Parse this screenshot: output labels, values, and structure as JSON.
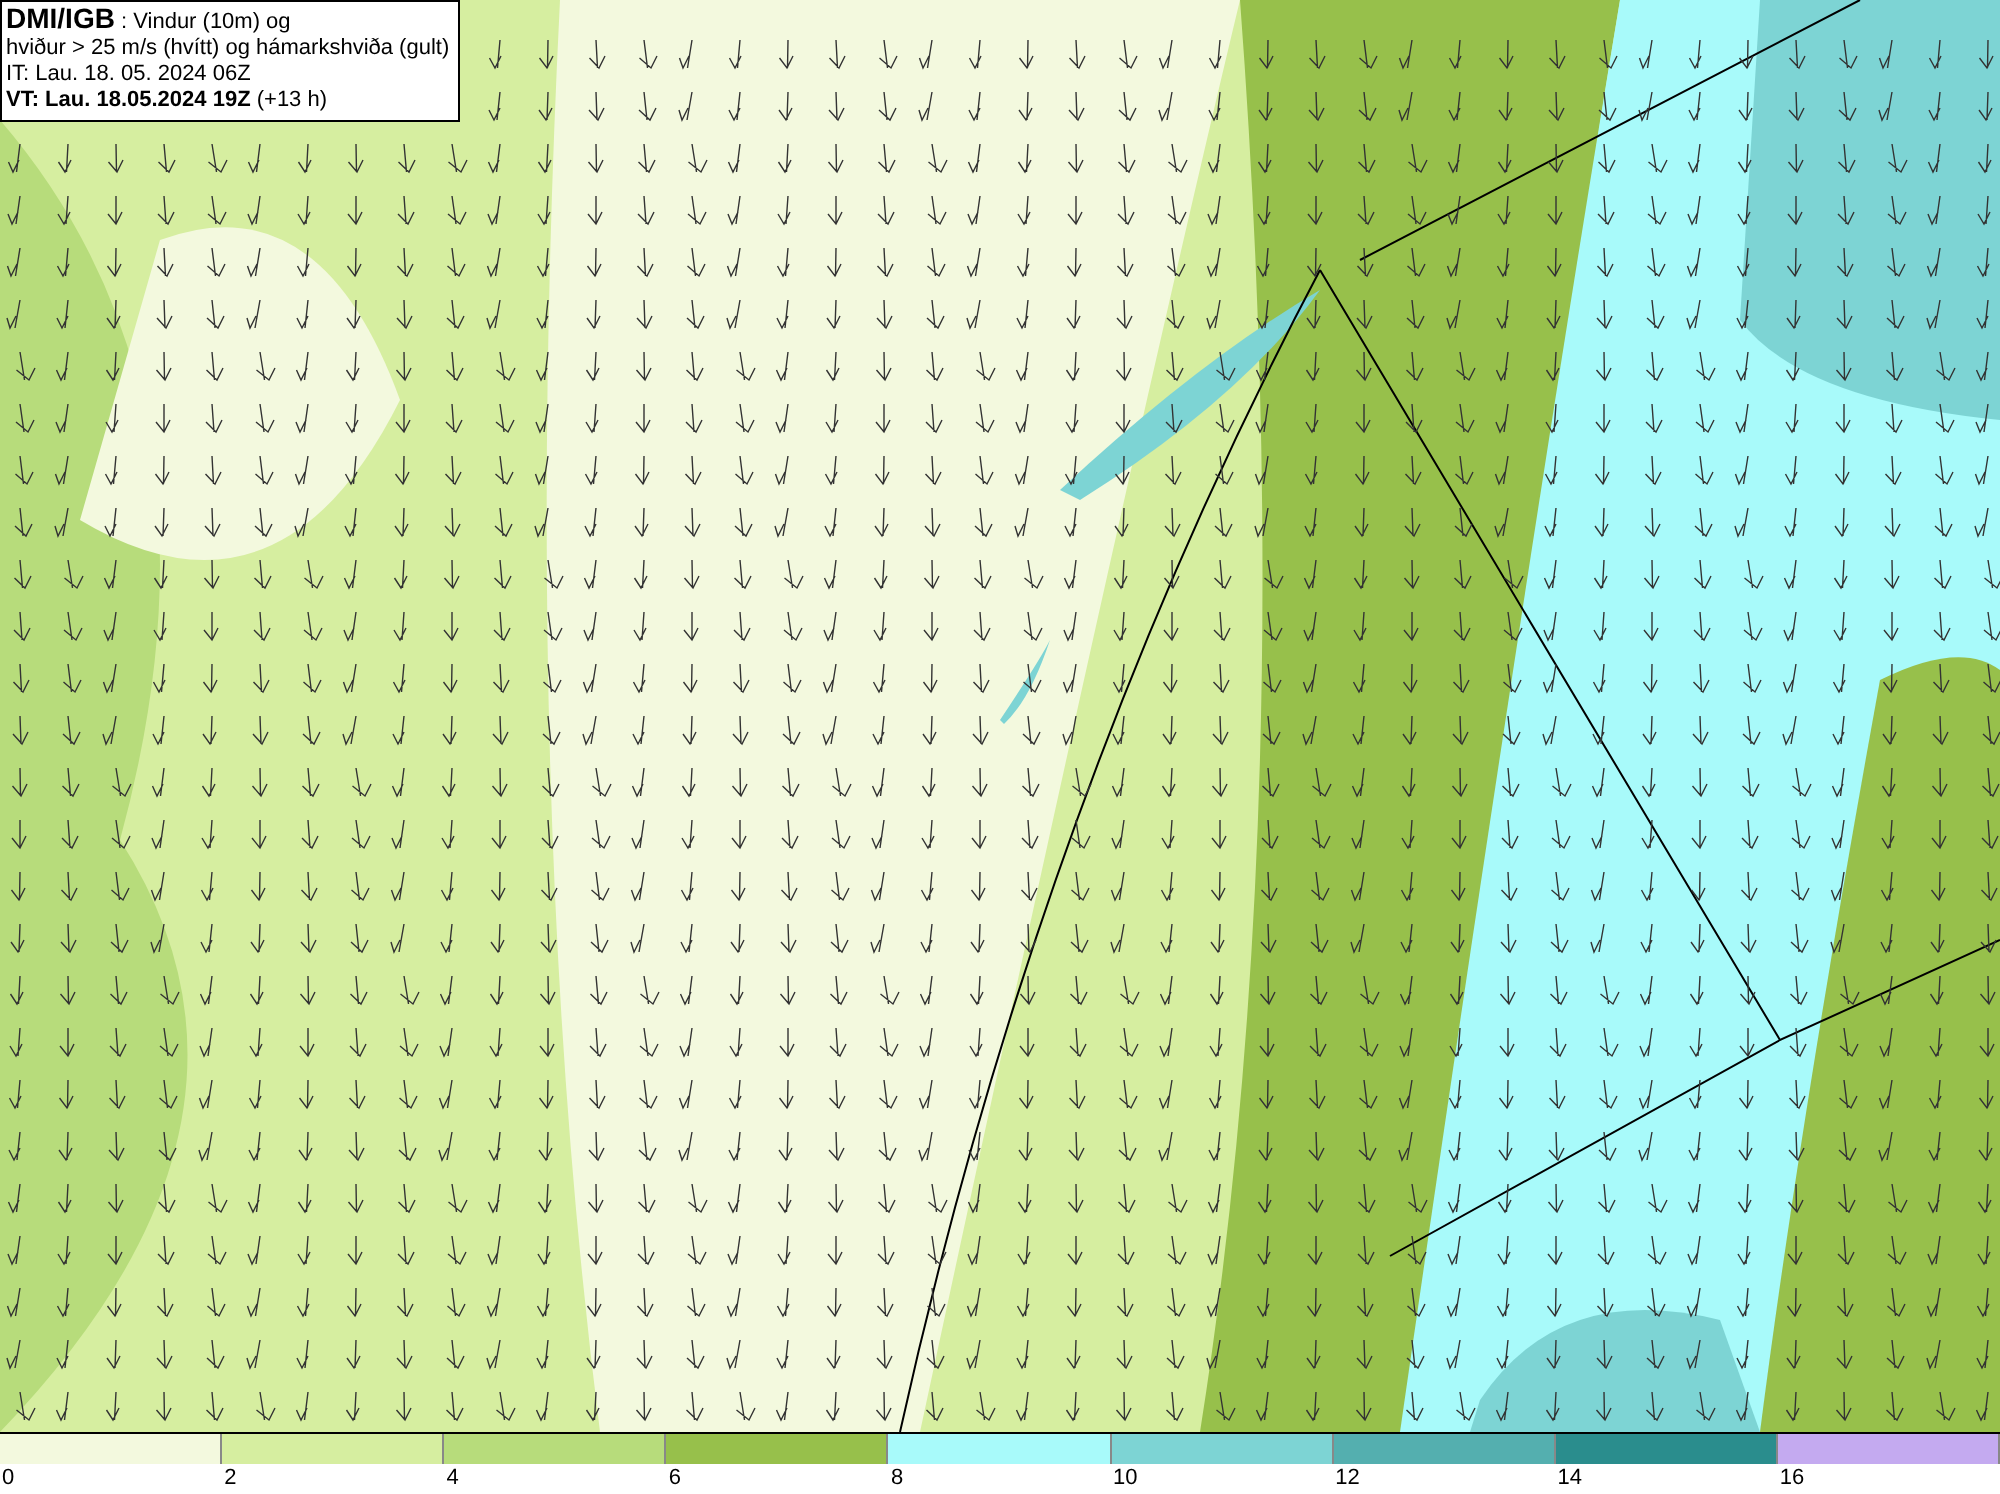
{
  "header": {
    "lines": [
      "**DMI/IGB** : Vindur (10m) og",
      "hviður > 25 m/s (hvítt) og hámarkshviða (gult)",
      "IT: Lau. 18. 05. 2024 06Z",
      "**VT: Lau. 18.05.2024 19Z** (+13 h)"
    ]
  },
  "legend": [
    {
      "color": "#f3f9de",
      "label": "0"
    },
    {
      "color": "#d6eea0",
      "label": "2"
    },
    {
      "color": "#b7dc7b",
      "label": "4"
    },
    {
      "color": "#97c04b",
      "label": "6"
    },
    {
      "color": "#a8fafa",
      "label": "8"
    },
    {
      "color": "#7dd4d4",
      "label": "10"
    },
    {
      "color": "#54afaf",
      "label": "12"
    },
    {
      "color": "#2a8d8d",
      "label": "14"
    },
    {
      "color": "#c4aaf0",
      "label": "16"
    }
  ]
}
